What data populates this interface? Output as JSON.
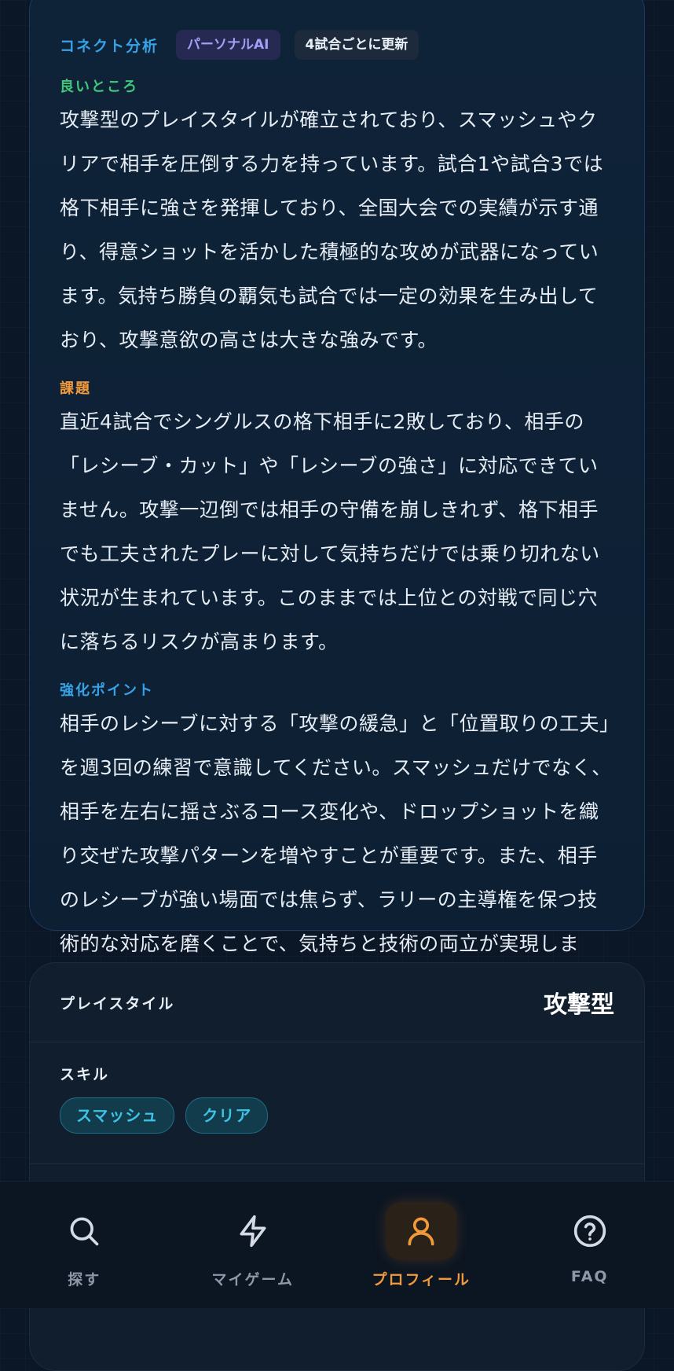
{
  "analysis": {
    "title": "コネクト分析",
    "badge_ai": "パーソナルAI",
    "badge_update": "4試合ごとに更新",
    "good": {
      "label": "良いところ",
      "text": "攻撃型のプレイスタイルが確立されており、スマッシュやクリアで相手を圧倒する力を持っています。試合1や試合3では格下相手に強さを発揮しており、全国大会での実績が示す通り、得意ショットを活かした積極的な攻めが武器になっています。気持ち勝負の覇気も試合では一定の効果を生み出しており、攻撃意欲の高さは大きな強みです。"
    },
    "issue": {
      "label": "課題",
      "text": "直近4試合でシングルスの格下相手に2敗しており、相手の「レシーブ・カット」や「レシーブの強さ」に対応できていません。攻撃一辺倒では相手の守備を崩しきれず、格下相手でも工夫されたプレーに対して気持ちだけでは乗り切れない状況が生まれています。このままでは上位との対戦で同じ穴に落ちるリスクが高まります。"
    },
    "boost": {
      "label": "強化ポイント",
      "text": "相手のレシーブに対する「攻撃の緩急」と「位置取りの工夫」を週3回の練習で意識してください。スマッシュだけでなく、相手を左右に揺さぶるコース変化や、ドロップショットを織り交ぜた攻撃パターンを増やすことが重要です。また、相手のレシーブが強い場面では焦らず、ラリーの主導権を保つ技術的な対応を磨くことで、気持ちと技術の両立が実現します。"
    }
  },
  "profile": {
    "playstyle_label": "プレイスタイル",
    "playstyle_value": "攻撃型",
    "skill_label": "スキル",
    "skills": [
      "スマッシュ",
      "クリア"
    ]
  },
  "nav": {
    "items": [
      {
        "label": "探す",
        "icon": "search-icon",
        "active": false
      },
      {
        "label": "マイゲーム",
        "icon": "lightning-icon",
        "active": false
      },
      {
        "label": "プロフィール",
        "icon": "user-icon",
        "active": true
      },
      {
        "label": "FAQ",
        "icon": "help-icon",
        "active": false
      }
    ]
  },
  "colors": {
    "background": "#0b1626",
    "good": "#3fc87b",
    "issue": "#f29a3a",
    "boost": "#36a3e8",
    "active_nav": "#f29a3a",
    "ai_badge": "#a39ef6",
    "skill_chip": "#3ec3e6"
  }
}
